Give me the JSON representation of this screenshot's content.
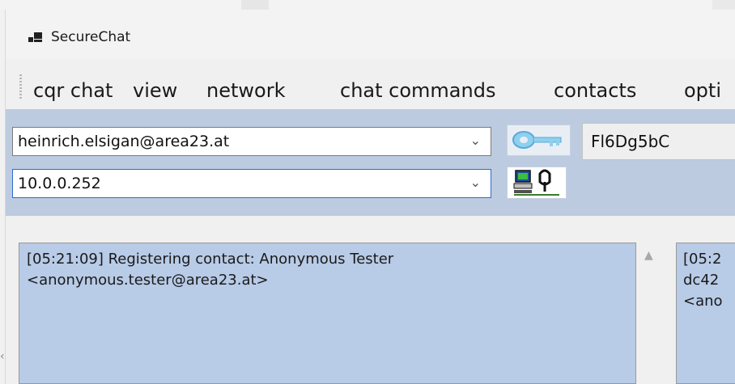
{
  "window": {
    "title": "SecureChat"
  },
  "menu": {
    "items": [
      "cqr chat",
      "view",
      "network",
      "chat commands",
      "contacts",
      "opti"
    ]
  },
  "toolbar": {
    "email_value": "heinrich.elsigan@area23.at",
    "ip_value": "10.0.0.252",
    "code_value": "Fl6Dg5bC",
    "key_icon": "key-icon",
    "network_icon": "network-computer-icon"
  },
  "chat": {
    "left_text": "[05:21:09] Registering contact: Anonymous Tester\n<anonymous.tester@area23.at>",
    "right_text": "[05:2\ndc42\n<ano"
  },
  "colors": {
    "toolbar_bg": "#bccbe0",
    "chat_bg": "#b8cbe7",
    "focus_border": "#2a6bd1"
  }
}
